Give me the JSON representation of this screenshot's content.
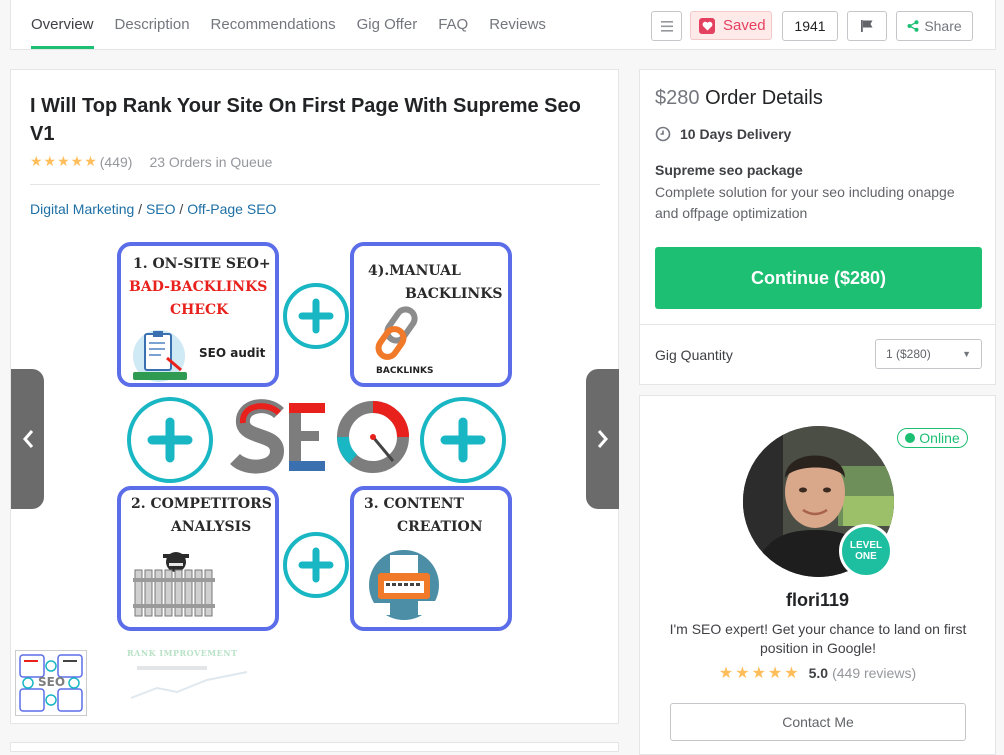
{
  "nav": {
    "tabs": [
      "Overview",
      "Description",
      "Recommendations",
      "Gig Offer",
      "FAQ",
      "Reviews"
    ],
    "active_tab": "Overview",
    "saved_label": "Saved",
    "save_count": "1941",
    "share_label": "Share"
  },
  "gig": {
    "title": "I Will Top Rank Your Site On First Page With Supreme Seo V1",
    "stars": "★★★★★",
    "rating_count": "(449)",
    "queue": "23 Orders in Queue",
    "breadcrumb": [
      "Digital Marketing",
      "SEO",
      "Off-Page SEO"
    ],
    "breadcrumb_sep": " / "
  },
  "image": {
    "card1_line1": "1. ON-SITE SEO+",
    "card1_line2": "BAD-BACKLINKS",
    "card1_line3": "CHECK",
    "card1_caption": "SEO audit",
    "card2_line1": "4).MANUAL",
    "card2_line2": "BACKLINKS",
    "card2_caption": "BACKLINKS",
    "card3_line1": "2. COMPETITORS",
    "card3_line2": "ANALYSIS",
    "card4_line1": "3. CONTENT",
    "card4_line2": "CREATION",
    "center_word": "SEO",
    "thumb2_caption": "RANK IMPROVEMENT"
  },
  "order": {
    "price": "$280",
    "title": "Order Details",
    "delivery": "10 Days Delivery",
    "package_name": "Supreme seo package",
    "package_desc": "Complete solution for your seo including onapge and offpage optimization",
    "continue_label": "Continue ($280)",
    "quantity_label": "Gig Quantity",
    "quantity_value": "1 ($280)"
  },
  "seller": {
    "status": "Online",
    "level_line1": "LEVEL",
    "level_line2": "ONE",
    "username": "flori119",
    "bio": "I'm SEO expert! Get your chance to land on first position in Google!",
    "stars": "★★★★★",
    "score": "5.0",
    "reviews": "(449 reviews)",
    "contact_label": "Contact Me"
  },
  "colors": {
    "accent": "#1dbf73",
    "saved": "#e4405f",
    "star": "#ffbe5b",
    "card_border": "#5b6de8",
    "plus": "#19b6c3"
  }
}
